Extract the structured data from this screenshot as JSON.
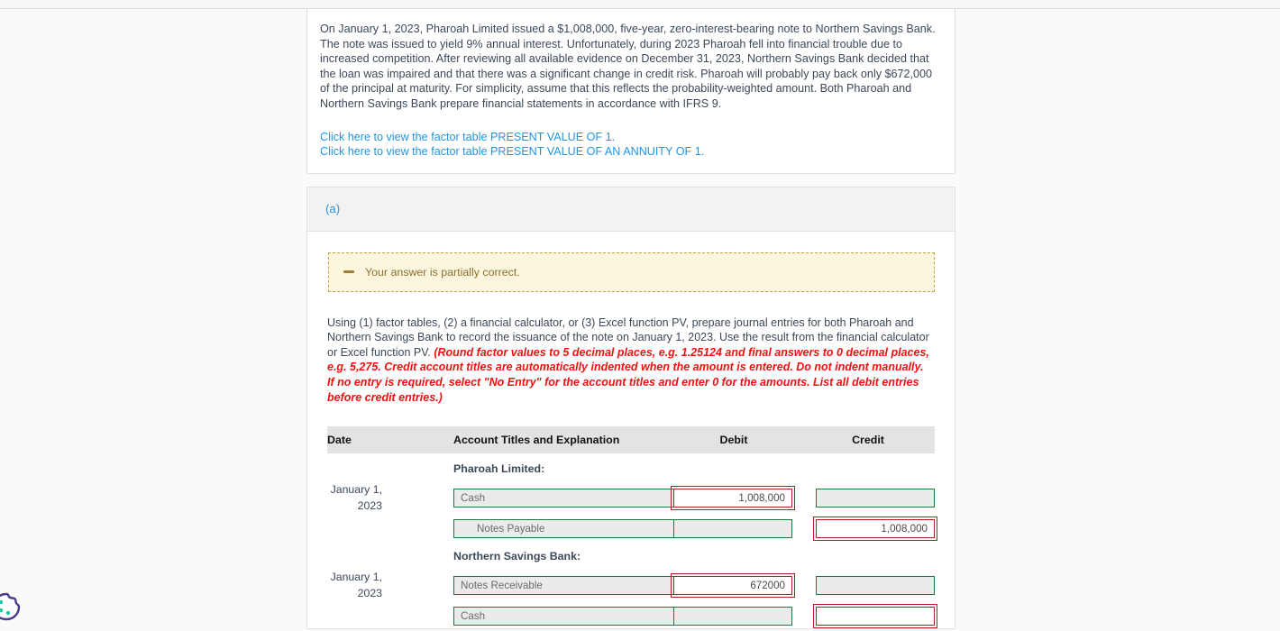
{
  "problem": {
    "statement": "On January 1, 2023, Pharoah Limited issued a $1,008,000, five-year, zero-interest-bearing note to Northern Savings Bank. The note was issued to yield 9% annual interest. Unfortunately, during 2023 Pharoah fell into financial trouble due to increased competition. After reviewing all available evidence on December 31, 2023, Northern Savings Bank decided that the loan was impaired and that there was a significant change in credit risk. Pharoah will probably pay back only $672,000 of the principal at maturity. For simplicity, assume that this reflects the probability-weighted amount. Both Pharoah and Northern Savings Bank prepare financial statements in accordance with IFRS 9.",
    "links": [
      "Click here to view the factor table PRESENT VALUE OF 1.",
      "Click here to view the factor table PRESENT VALUE OF AN ANNUITY OF 1."
    ]
  },
  "section": {
    "label": "(a)",
    "alert": {
      "icon": "minus-icon",
      "text": "Your answer is partially correct."
    },
    "instructions_plain": "Using (1) factor tables, (2) a financial calculator, or (3) Excel function PV, prepare journal entries for both Pharoah and Northern Savings Bank to record the issuance of the note on January 1, 2023. Use the result from the financial calculator or Excel function PV. ",
    "instructions_emphasis": "(Round factor values to 5 decimal places, e.g. 1.25124 and final answers to 0 decimal places, e.g. 5,275. Credit account titles are automatically indented when the amount is entered. Do not indent manually. If no entry is required, select \"No Entry\" for the account titles and enter 0 for the amounts. List all debit entries before credit entries.)"
  },
  "journal": {
    "columns": {
      "date": "Date",
      "account": "Account Titles and Explanation",
      "debit": "Debit",
      "credit": "Credit"
    },
    "groups": [
      {
        "title": "Pharoah Limited:",
        "rows": [
          {
            "date": "January 1, 2023",
            "account": "Cash",
            "account_indent": false,
            "account_state": "ok",
            "debit": "1,008,000",
            "debit_state": "error",
            "credit": "",
            "credit_state": "ok"
          },
          {
            "date": "",
            "account": "Notes Payable",
            "account_indent": true,
            "account_state": "ok",
            "debit": "",
            "debit_state": "ok",
            "credit": "1,008,000",
            "credit_state": "error"
          }
        ]
      },
      {
        "title": "Northern Savings Bank:",
        "rows": [
          {
            "date": "January 1, 2023",
            "account": "Notes Receivable",
            "account_indent": false,
            "account_state": "ok",
            "debit": "672000",
            "debit_state": "error",
            "credit": "",
            "credit_state": "ok"
          },
          {
            "date": "",
            "account": "Cash",
            "account_indent": false,
            "account_state": "ok",
            "debit": "",
            "debit_state": "ok",
            "credit": "",
            "credit_state": "error"
          }
        ]
      }
    ]
  },
  "widgets": {
    "cookie_icon": "cookie-consent-icon"
  },
  "colors": {
    "link": "#2196e3",
    "error_border": "#b01f24",
    "ok_border": "#1c7a3e",
    "alert_bg": "#fbf6dd",
    "alert_text": "#8a7030",
    "emphasis": "#f20f0f"
  }
}
